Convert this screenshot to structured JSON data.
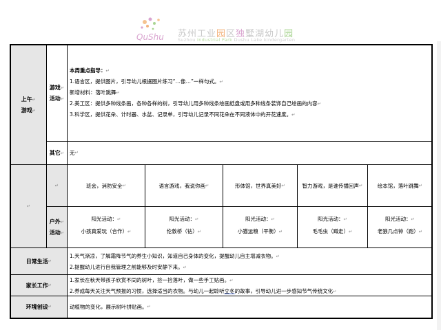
{
  "header": {
    "logo_mark_text": "QuShu",
    "title_a": "苏州工业",
    "title_b": "园",
    "title_c": "区",
    "title_d": "独",
    "title_e": "墅湖幼儿",
    "title_f": "园",
    "subtitle_a": "Suzhou ",
    "subtitle_b": "Industrial Park ",
    "subtitle_c": "Dushu Lake kindergarten"
  },
  "colors": {
    "label_bg": "#e6e6e6",
    "border": "#000000",
    "mark": "#888888"
  },
  "para_mark": "↵",
  "morning": {
    "label_1": "上午",
    "label_2": "游戏",
    "game_label_1": "游戏",
    "game_label_2": "活动",
    "focus_title": "本周重点指导：",
    "lines": [
      "1.语言区，提供图片，引导幼儿根据图片练习“…像…”一样句式。",
      "新增材料：落叶跳舞",
      "2.美工区：提供多种线条画，各种各样的树，引导幼儿用多种线条绘画纸盘或用多种线条装饰自己绘画的内容",
      "3.科学区，提供花朵、计时器、水盆、记录单，引导幼儿记录不同花朵在不同液体中的开花速度。"
    ],
    "other_label": "其它",
    "other_value": "无"
  },
  "activities": {
    "top": [
      "班会，消防安全",
      "语言游戏，我说你画",
      "形体馆，世界真美好",
      "智力游戏，是谁传播回声",
      "绘本馆，落叶跳舞"
    ],
    "outdoor_label_1": "户外",
    "outdoor_label_2": "活动",
    "bottom": [
      {
        "title": "阳光活动：",
        "name": "小孩真爱玩（合作）"
      },
      {
        "title": "阳光活动：",
        "name": "伦敦桥（钻）"
      },
      {
        "title": "阳光活动：",
        "name": "小猫运粮（平衡）"
      },
      {
        "title": "阳光活动：",
        "name": "毛毛虫（蹲走）"
      },
      {
        "title": "阳光活动：",
        "name": "老狼几点钟（跑）"
      }
    ]
  },
  "daily": {
    "label": "日常生活",
    "lines": [
      "1.天气渐凉，了解霜降节气的养生小知识，知道自己身体的变化，提醒幼儿自主增减衣物。",
      "2.提醒幼儿进行自我管理之前能够及时安静下来。"
    ]
  },
  "home": {
    "label": "家长工作",
    "line1": "1.家长在秋天带孩子欣赏不同的树叶，捡一捡落叶，做一些手工贴画。",
    "line2_a": "2.养成每天关注天气预报的习惯，选择适当的衣物。与幼儿一起聆听",
    "line2_b": "立冬",
    "line2_c": "的故事，引导幼儿进一步感知节气传统文化"
  },
  "env": {
    "label": "环境创设",
    "value": "动植物的变化，展示树叶拼贴画。"
  }
}
